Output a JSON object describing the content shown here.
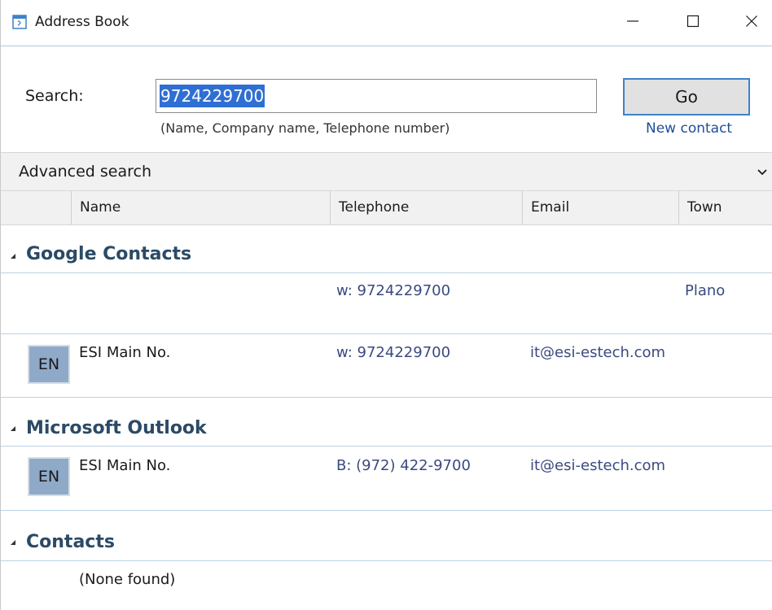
{
  "window": {
    "title": "Address Book"
  },
  "search": {
    "label": "Search:",
    "value": "9724229700",
    "hint": "(Name, Company name, Telephone number)",
    "go_label": "Go",
    "new_contact_label": "New contact"
  },
  "advanced": {
    "label": "Advanced search"
  },
  "columns": {
    "name": "Name",
    "telephone": "Telephone",
    "email": "Email",
    "town": "Town"
  },
  "groups": [
    {
      "title": "Google Contacts",
      "rows": [
        {
          "avatar": "",
          "name": "",
          "telephone": "w: 9724229700",
          "email": "",
          "town": "Plano"
        },
        {
          "avatar": "EN",
          "name": "ESI Main No.",
          "telephone": "w: 9724229700",
          "email": "it@esi-estech.com",
          "town": ""
        }
      ]
    },
    {
      "title": "Microsoft Outlook",
      "rows": [
        {
          "avatar": "EN",
          "name": "ESI Main No.",
          "telephone": "B: (972) 422-9700",
          "email": "it@esi-estech.com",
          "town": ""
        }
      ]
    },
    {
      "title": "Contacts",
      "empty_text": "(None found)"
    }
  ],
  "colors": {
    "accent": "#3f82c7",
    "selection": "#2f6fd4",
    "group_title": "#2b4a66",
    "link": "#1f4e9a",
    "avatar_bg": "#8fa9c8"
  },
  "icons": {
    "app": "address-book-icon",
    "minimize": "minimize-icon",
    "maximize": "maximize-icon",
    "close": "close-icon",
    "expand": "chevron-down-icon",
    "group_toggle": "collapse-triangle-icon"
  }
}
